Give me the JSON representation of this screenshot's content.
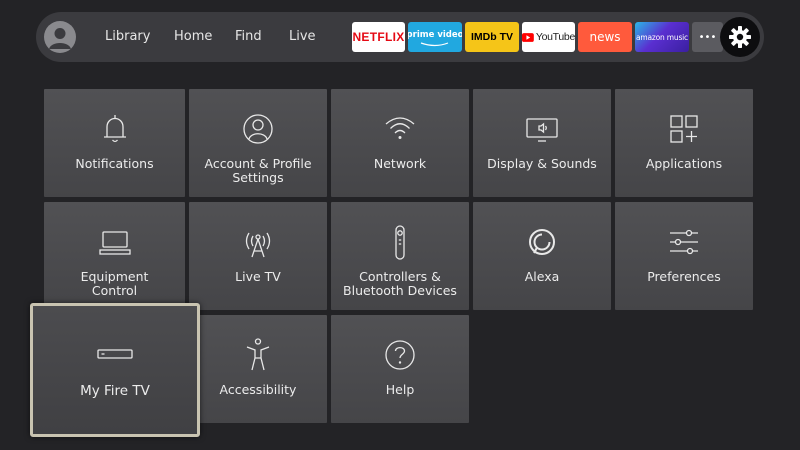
{
  "nav": {
    "items": [
      "Library",
      "Home",
      "Find",
      "Live"
    ]
  },
  "apps": [
    {
      "label": "NETFLIX",
      "bg": "#ffffff",
      "fg": "#e50914"
    },
    {
      "label": "prime video",
      "bg": "#21a8e0",
      "fg": "#ffffff"
    },
    {
      "label": "IMDb TV",
      "bg": "#f5c518",
      "fg": "#000000"
    },
    {
      "label": "YouTube",
      "bg": "#ffffff",
      "fg": "#222222"
    },
    {
      "label": "news",
      "bg": "#ff5a3c",
      "fg": "#ffffff"
    },
    {
      "label": "amazon music",
      "bg": "#5a2fd0",
      "fg": "#ffffff"
    },
    {
      "label": "•••",
      "bg": "#5b5b60",
      "fg": "#ffffff"
    }
  ],
  "settings": [
    {
      "label": "Notifications",
      "icon": "bell-icon"
    },
    {
      "label": "Account & Profile Settings",
      "icon": "user-icon"
    },
    {
      "label": "Network",
      "icon": "wifi-icon"
    },
    {
      "label": "Display & Sounds",
      "icon": "display-icon"
    },
    {
      "label": "Applications",
      "icon": "apps-grid-icon"
    },
    {
      "label": "Equipment Control",
      "icon": "tv-icon"
    },
    {
      "label": "Live TV",
      "icon": "antenna-icon"
    },
    {
      "label": "Controllers & Bluetooth Devices",
      "icon": "remote-icon"
    },
    {
      "label": "Alexa",
      "icon": "alexa-icon"
    },
    {
      "label": "Preferences",
      "icon": "sliders-icon"
    },
    {
      "label": "My Fire TV",
      "icon": "fire-tv-stick-icon"
    },
    {
      "label": "Accessibility",
      "icon": "accessibility-icon"
    },
    {
      "label": "Help",
      "icon": "help-icon"
    }
  ],
  "colors": {
    "background": "#232326",
    "tile": "#4a4a4d",
    "focus_border": "#c9c4b1",
    "navbar": "#3b3b3f"
  }
}
